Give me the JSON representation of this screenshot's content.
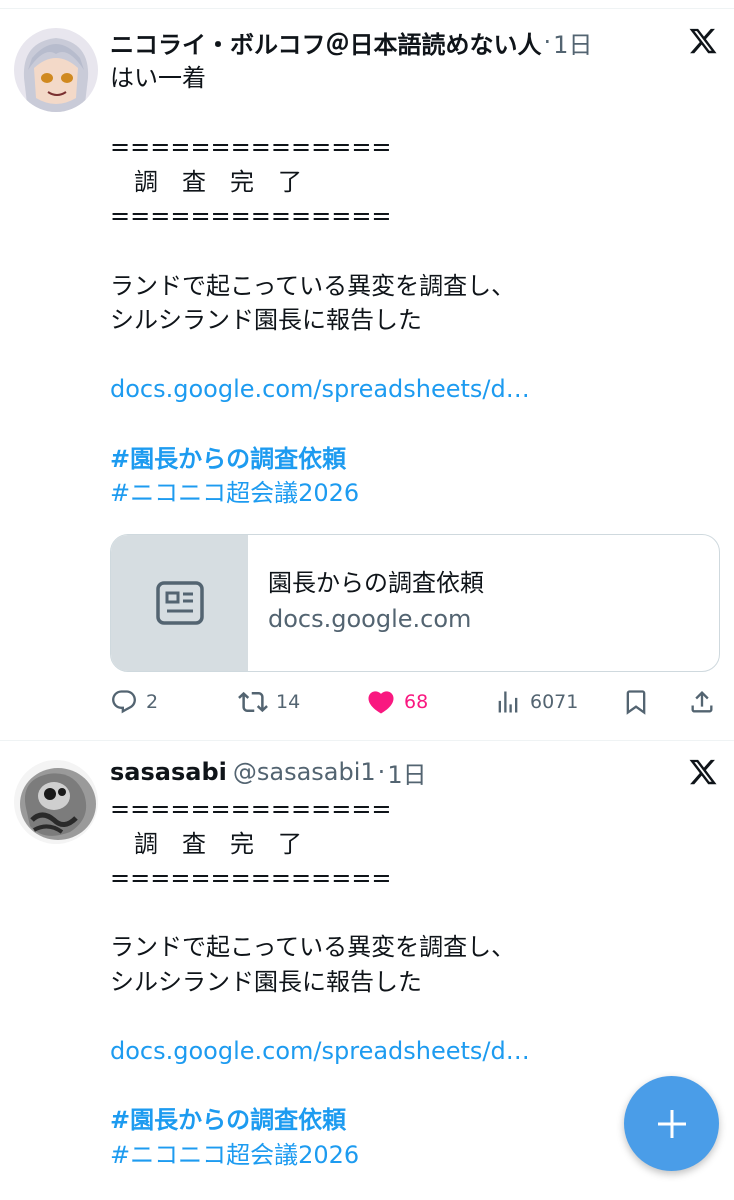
{
  "tweets": [
    {
      "author_name": "ニコライ・ボルコフ＠日本語読めない人",
      "handle": "",
      "time": "1日",
      "lines": [
        "はい一着",
        "",
        "==============",
        "　調　査　完　了",
        "==============",
        "",
        "ランドで起こっている異変を調査し、",
        "シルシランド園長に報告した",
        ""
      ],
      "link": "docs.google.com/spreadsheets/d…",
      "hashtags": [
        "#園長からの調査依頼",
        "#ニコニコ超会議2026"
      ],
      "card": {
        "title": "園長からの調査依頼",
        "domain": "docs.google.com"
      },
      "stats": {
        "replies": "2",
        "retweets": "14",
        "likes": "68",
        "views": "6071"
      },
      "accent": {
        "link": "#1d9bf0",
        "like": "#f91880"
      }
    },
    {
      "author_name": "sasasabi",
      "handle": "@sasasabi1",
      "time": "1日",
      "lines": [
        "==============",
        "　調　査　完　了",
        "==============",
        "",
        "ランドで起こっている異変を調査し、",
        "シルシランド園長に報告した",
        ""
      ],
      "link": "docs.google.com/spreadsheets/d…",
      "hashtags": [
        "#園長からの調査依頼",
        "#ニコニコ超会議2026"
      ]
    }
  ],
  "icons": {
    "reply": "reply-icon",
    "retweet": "retweet-icon",
    "like": "heart-icon",
    "views": "views-icon",
    "bookmark": "bookmark-icon",
    "share": "share-icon",
    "card": "article-icon",
    "x": "x-logo-icon",
    "compose": "plus-icon"
  }
}
